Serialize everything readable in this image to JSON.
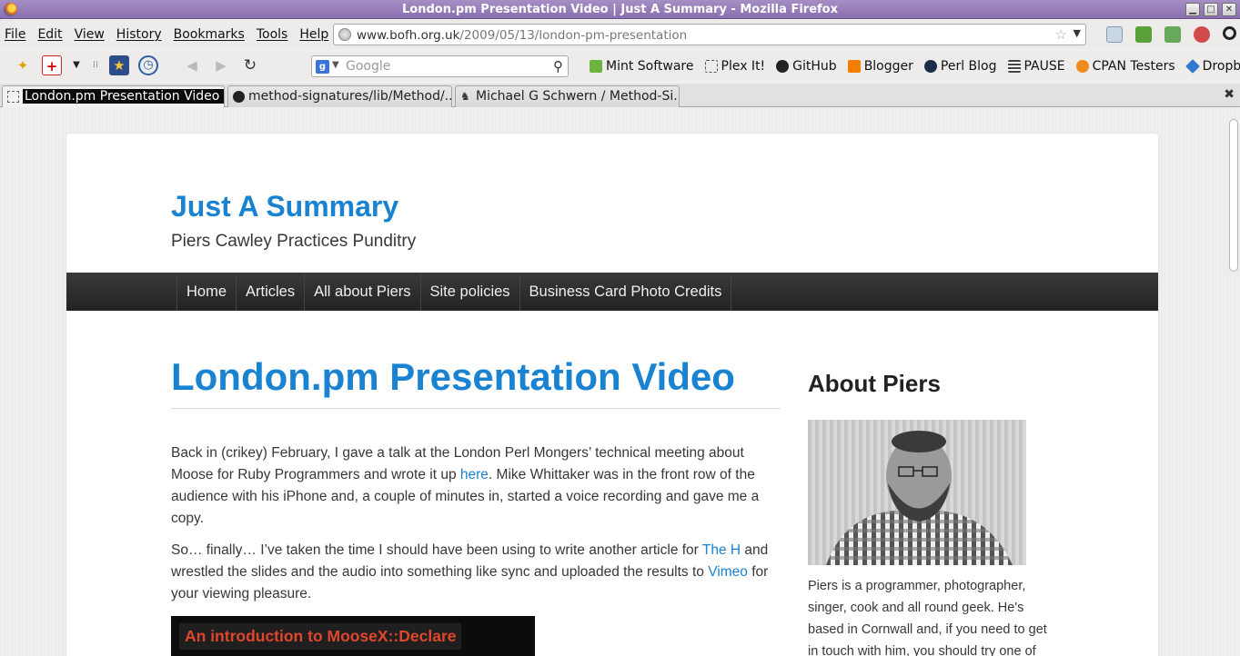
{
  "window": {
    "title": "London.pm Presentation Video | Just A Summary - Mozilla Firefox",
    "minimize": "▁",
    "maximize": "□",
    "close": "✕"
  },
  "menu": [
    "File",
    "Edit",
    "View",
    "History",
    "Bookmarks",
    "Tools",
    "Help"
  ],
  "url": {
    "domain": "www.bofh.org.uk",
    "path": "/2009/05/13/london-pm-presentation"
  },
  "search": {
    "placeholder": "Google",
    "engine_icon": "g"
  },
  "bookmarks": [
    {
      "label": "Mint Software",
      "icon": "mint-icon",
      "color": "#6cb33f"
    },
    {
      "label": "Plex It!",
      "icon": "dotted-box-icon",
      "color": "#ffffff"
    },
    {
      "label": "GitHub",
      "icon": "github-icon",
      "color": "#222222"
    },
    {
      "label": "Blogger",
      "icon": "blogger-icon",
      "color": "#f57d00"
    },
    {
      "label": "Perl Blog",
      "icon": "onion-icon",
      "color": "#1b2b4a"
    },
    {
      "label": "PAUSE",
      "icon": "lines-icon",
      "color": "#444444"
    },
    {
      "label": "CPAN Testers",
      "icon": "cpan-icon",
      "color": "#f08a1c"
    },
    {
      "label": "Dropbox",
      "icon": "dropbox-icon",
      "color": "#2e7ad0"
    }
  ],
  "tabs": [
    {
      "label": "London.pm Presentation Video |...",
      "active": true
    },
    {
      "label": "method-signatures/lib/Method/...",
      "active": false
    },
    {
      "label": "Michael G Schwern / Method-Si...",
      "active": false
    }
  ],
  "site": {
    "title": "Just A Summary",
    "description": "Piers Cawley Practices Punditry",
    "nav": [
      "Home",
      "Articles",
      "All about Piers",
      "Site policies",
      "Business Card Photo Credits"
    ]
  },
  "post": {
    "title": "London.pm Presentation Video",
    "p1_a": "Back in (crikey) February, I gave a talk at the London Perl Mongers’ technical meeting about Moose for Ruby Programmers and wrote it up ",
    "p1_link": "here",
    "p1_b": ". Mike Whittaker was in the front row of the audience with his iPhone and, a couple of minutes in, started a voice recording and gave me a copy.",
    "p2_a": "So… finally… I’ve taken the time I should have been using to write another article for ",
    "p2_link1": "The H",
    "p2_b": " and wrestled the slides and the audio into something like sync and uploaded the results to ",
    "p2_link2": "Vimeo",
    "p2_c": " for your viewing pleasure.",
    "video_label": "An introduction to MooseX::Declare"
  },
  "sidebar": {
    "title": "About Piers",
    "text": "Piers is a programmer, photographer, singer, cook and all round geek. He's based in Cornwall and, if you need to get in touch with him, you should try one of"
  },
  "colors": {
    "link": "#1982d1",
    "accent_titlebar": "#8a6fb0",
    "nav_bg": "#222222"
  }
}
